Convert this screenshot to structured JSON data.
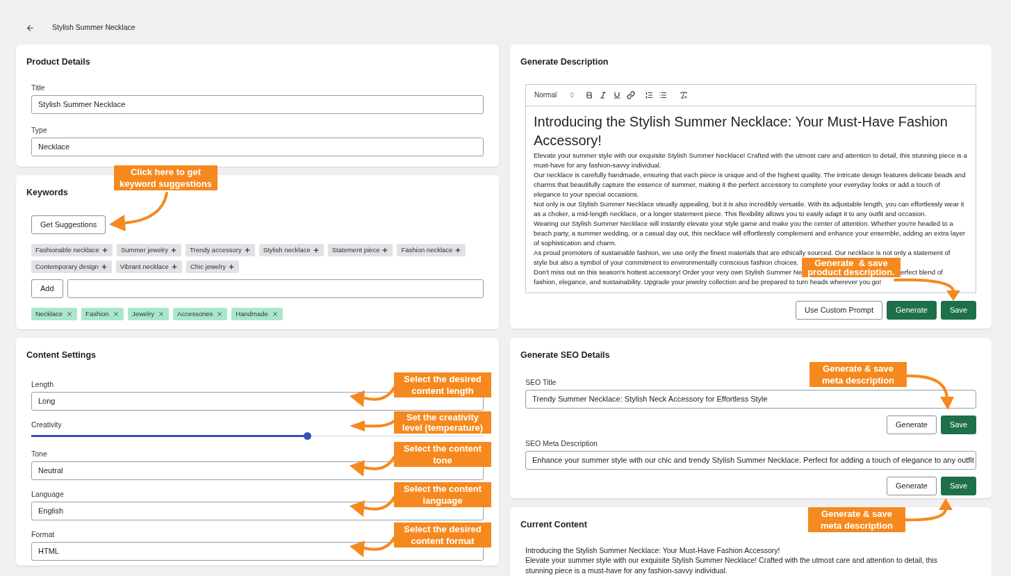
{
  "page": {
    "title": "Stylish Summer Necklace"
  },
  "product_details": {
    "heading": "Product Details",
    "fields": [
      {
        "label": "Title",
        "value": "Stylish Summer Necklace"
      },
      {
        "label": "Type",
        "value": "Necklace"
      }
    ]
  },
  "keywords": {
    "heading": "Keywords",
    "callout": [
      "Click here to get",
      "keyword suggestions"
    ],
    "suggest_button": "Get Suggestions",
    "suggestions": [
      "Fashionable necklace",
      "Summer jewelry",
      "Trendy accessory",
      "Stylish necklace",
      "Statement piece",
      "Fashion necklace",
      "Contemporary design",
      "Vibrant necklace",
      "Chic jewelry"
    ],
    "add_button": "Add",
    "tags": [
      "Necklace",
      "Fashion",
      "Jewelry",
      "Accessories",
      "Handmade"
    ]
  },
  "content_settings": {
    "heading": "Content Settings",
    "settings": [
      {
        "kind": "select",
        "label": "Length",
        "value": "Long",
        "callout": [
          "Select the desired",
          "content length"
        ]
      },
      {
        "kind": "slider",
        "label": "Creativity",
        "level": 0.61,
        "callout": [
          "Set the creativity",
          "level (temperature)"
        ]
      },
      {
        "kind": "select",
        "label": "Tone",
        "value": "Neutral",
        "callout": [
          "Select the content",
          "tone"
        ]
      },
      {
        "kind": "select",
        "label": "Language",
        "value": "English",
        "callout": [
          "Select the content",
          "language"
        ]
      },
      {
        "kind": "select",
        "label": "Format",
        "value": "HTML",
        "callout": [
          "Select the desired",
          "content format"
        ]
      }
    ]
  },
  "generate_description": {
    "heading": "Generate Description",
    "text_style": "Normal",
    "editor": {
      "heading": "Introducing the Stylish Summer Necklace: Your Must-Have Fashion Accessory!",
      "paragraphs": [
        "Elevate your summer style with our exquisite Stylish Summer Necklace! Crafted with the utmost care and attention to detail, this stunning piece is a must-have for any fashion-savvy individual.",
        "Our necklace is carefully handmade, ensuring that each piece is unique and of the highest quality. The intricate design features delicate beads and charms that beautifully capture the essence of summer, making it the perfect accessory to complete your everyday looks or add a touch of elegance to your special occasions.",
        "Not only is our Stylish Summer Necklace visually appealing, but it is also incredibly versatile. With its adjustable length, you can effortlessly wear it as a choker, a mid-length necklace, or a longer statement piece. This flexibility allows you to easily adapt it to any outfit and occasion.",
        "Wearing our Stylish Summer Necklace will instantly elevate your style game and make you the center of attention. Whether you're headed to a beach party, a summer wedding, or a casual day out, this necklace will effortlessly complement and enhance your ensemble, adding an extra layer of sophistication and charm."
      ],
      "paragraph_lines": [
        "As proud promoters of sustainable fashion, we use only the finest materials that are ethically sourced. Our necklace is not only a statement of",
        "style but also a symbol of your commitment to environmentally conscious fashion choices."
      ],
      "last_before": "Don't miss out on this season's hottest accessory! Order your very own Stylish Summer Ne",
      "last_after": "erfect blend of",
      "last_line": "fashion, elegance, and sustainability. Upgrade your jewelry collection and be prepared to turn heads wherever you go!"
    },
    "callout": [
      "Generate  & save",
      "product description."
    ],
    "buttons": [
      {
        "label": "Use Custom Prompt",
        "kind": "outline"
      },
      {
        "label": "Generate",
        "kind": "primary"
      },
      {
        "label": "Save",
        "kind": "primary"
      }
    ]
  },
  "seo": {
    "heading": "Generate SEO Details",
    "fields": [
      {
        "label": "SEO Title",
        "value": "Trendy Summer Necklace: Stylish Neck Accessory for Effortless Style",
        "callout": [
          "Generate & save",
          "meta description"
        ],
        "buttons": [
          {
            "label": "Generate",
            "kind": "outline"
          },
          {
            "label": "Save",
            "kind": "primary"
          }
        ]
      },
      {
        "label": "SEO Meta Description",
        "value": "Enhance your summer style with our chic and trendy Stylish Summer Necklace. Perfect for adding a touch of elegance to any outfit",
        "callout": [
          "Generate & save",
          "meta description"
        ],
        "buttons": [
          {
            "label": "Generate",
            "kind": "outline"
          },
          {
            "label": "Save",
            "kind": "primary"
          }
        ]
      }
    ]
  },
  "current_content": {
    "heading": "Current Content",
    "paragraphs": [
      "Introducing the Stylish Summer Necklace: Your Must-Have Fashion Accessory!",
      "Elevate your summer style with our exquisite Stylish Summer Necklace! Crafted with the utmost care and attention to detail, this stunning piece is a must-have for any fashion-savvy individual."
    ]
  }
}
